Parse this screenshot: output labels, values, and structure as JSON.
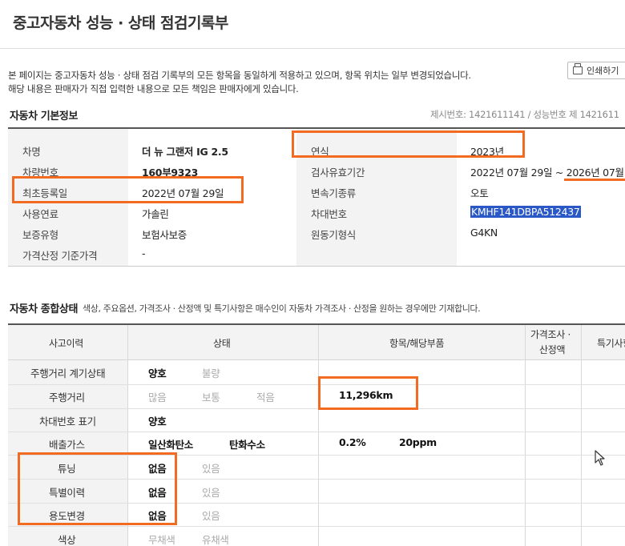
{
  "page": {
    "title": "중고자동차 성능 · 상태 점검기록부",
    "notice_line1": "본 페이지는 중고자동차 성능 · 상태 점검 기록부의 모든 항목을 동일하게 적용하고 있으며, 항목 위치는 일부 변경되었습니다.",
    "notice_line2": "해당 내용은 판매자가 직접 입력한 내용으로 모든 책임은 판매자에게 있습니다.",
    "print_label": "인쇄하기"
  },
  "basic": {
    "title": "자동차 기본정보",
    "meta": "제시번호: 1421611141 / 성능번호 제 1421611",
    "left": [
      {
        "label": "차명",
        "value": "더 뉴 그랜저 IG 2.5",
        "bold": true
      },
      {
        "label": "차량번호",
        "value": "160부9323",
        "bold": true
      },
      {
        "label": "최초등록일",
        "value": "2022년 07월 29일",
        "bold": false
      },
      {
        "label": "사용연료",
        "value": "가솔린",
        "bold": false
      },
      {
        "label": "보증유형",
        "value": "보험사보증",
        "bold": false
      },
      {
        "label": "가격산정 기준가격",
        "value": "-",
        "bold": false
      }
    ],
    "right": [
      {
        "label": "연식",
        "value": "2023년"
      },
      {
        "label": "검사유효기간",
        "value": "2022년 07월 29일 ~ 2026년 07월"
      },
      {
        "label": "변속기종류",
        "value": "오토"
      },
      {
        "label": "차대번호",
        "value": "KMHF141DBPA512437"
      },
      {
        "label": "원동기형식",
        "value": "G4KN"
      }
    ]
  },
  "status": {
    "title": "자동차 종합상태",
    "subtitle": "색상, 주요옵션, 가격조사 · 산정액 및 특기사항은 매수인이 자동차 가격조사 · 산정을 원하는 경우에만 기재합니다.",
    "headers": {
      "history": "사고이력",
      "state": "상태",
      "item": "항목/해당부품",
      "price_1": "가격조사 ·",
      "price_2": "산정액",
      "special": "특기사항"
    },
    "rows": [
      {
        "label": "주행거리 계기상태",
        "opt1": "양호",
        "opt2": "불량"
      },
      {
        "label": "주행거리",
        "opt1": "많음",
        "opt2": "보통",
        "opt3": "적음",
        "item": "11,296km"
      },
      {
        "label": "차대번호 표기",
        "opt1": "양호"
      },
      {
        "label": "배출가스",
        "opt1": "일산화탄소",
        "opt2": "탄화수소",
        "val1": "0.2%",
        "val2": "20ppm"
      },
      {
        "label": "튜닝",
        "opt1": "없음",
        "opt2": "있음"
      },
      {
        "label": "특별이력",
        "opt1": "없음",
        "opt2": "있음"
      },
      {
        "label": "용도변경",
        "opt1": "없음",
        "opt2": "있음"
      },
      {
        "label": "색상",
        "opt1": "무채색",
        "opt2": "유채색"
      }
    ]
  },
  "colors": {
    "highlight": "#f26b22",
    "selection": "#2a58c7"
  }
}
